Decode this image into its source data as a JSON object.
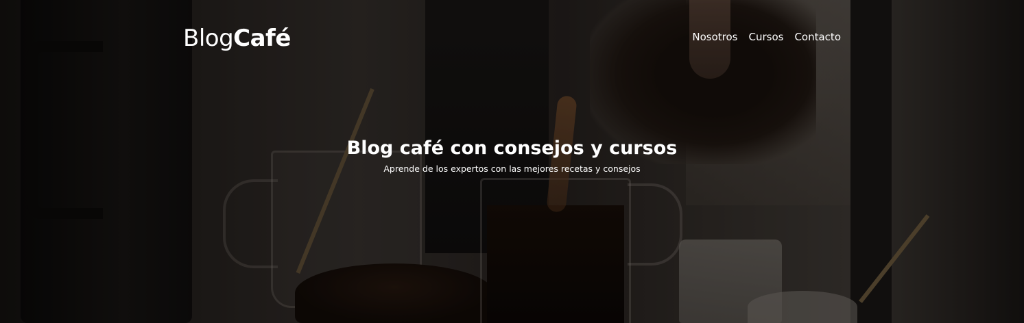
{
  "header": {
    "logo_light": "Blog",
    "logo_bold": "Café"
  },
  "nav": {
    "items": [
      {
        "label": "Nosotros"
      },
      {
        "label": "Cursos"
      },
      {
        "label": "Contacto"
      }
    ]
  },
  "hero": {
    "title": "Blog café con consejos y cursos",
    "subtitle": "Aprende de los expertos con las mejores recetas y consejos"
  },
  "colors": {
    "text": "#ffffff",
    "overlay": "rgba(0,0,0,0.38)"
  }
}
